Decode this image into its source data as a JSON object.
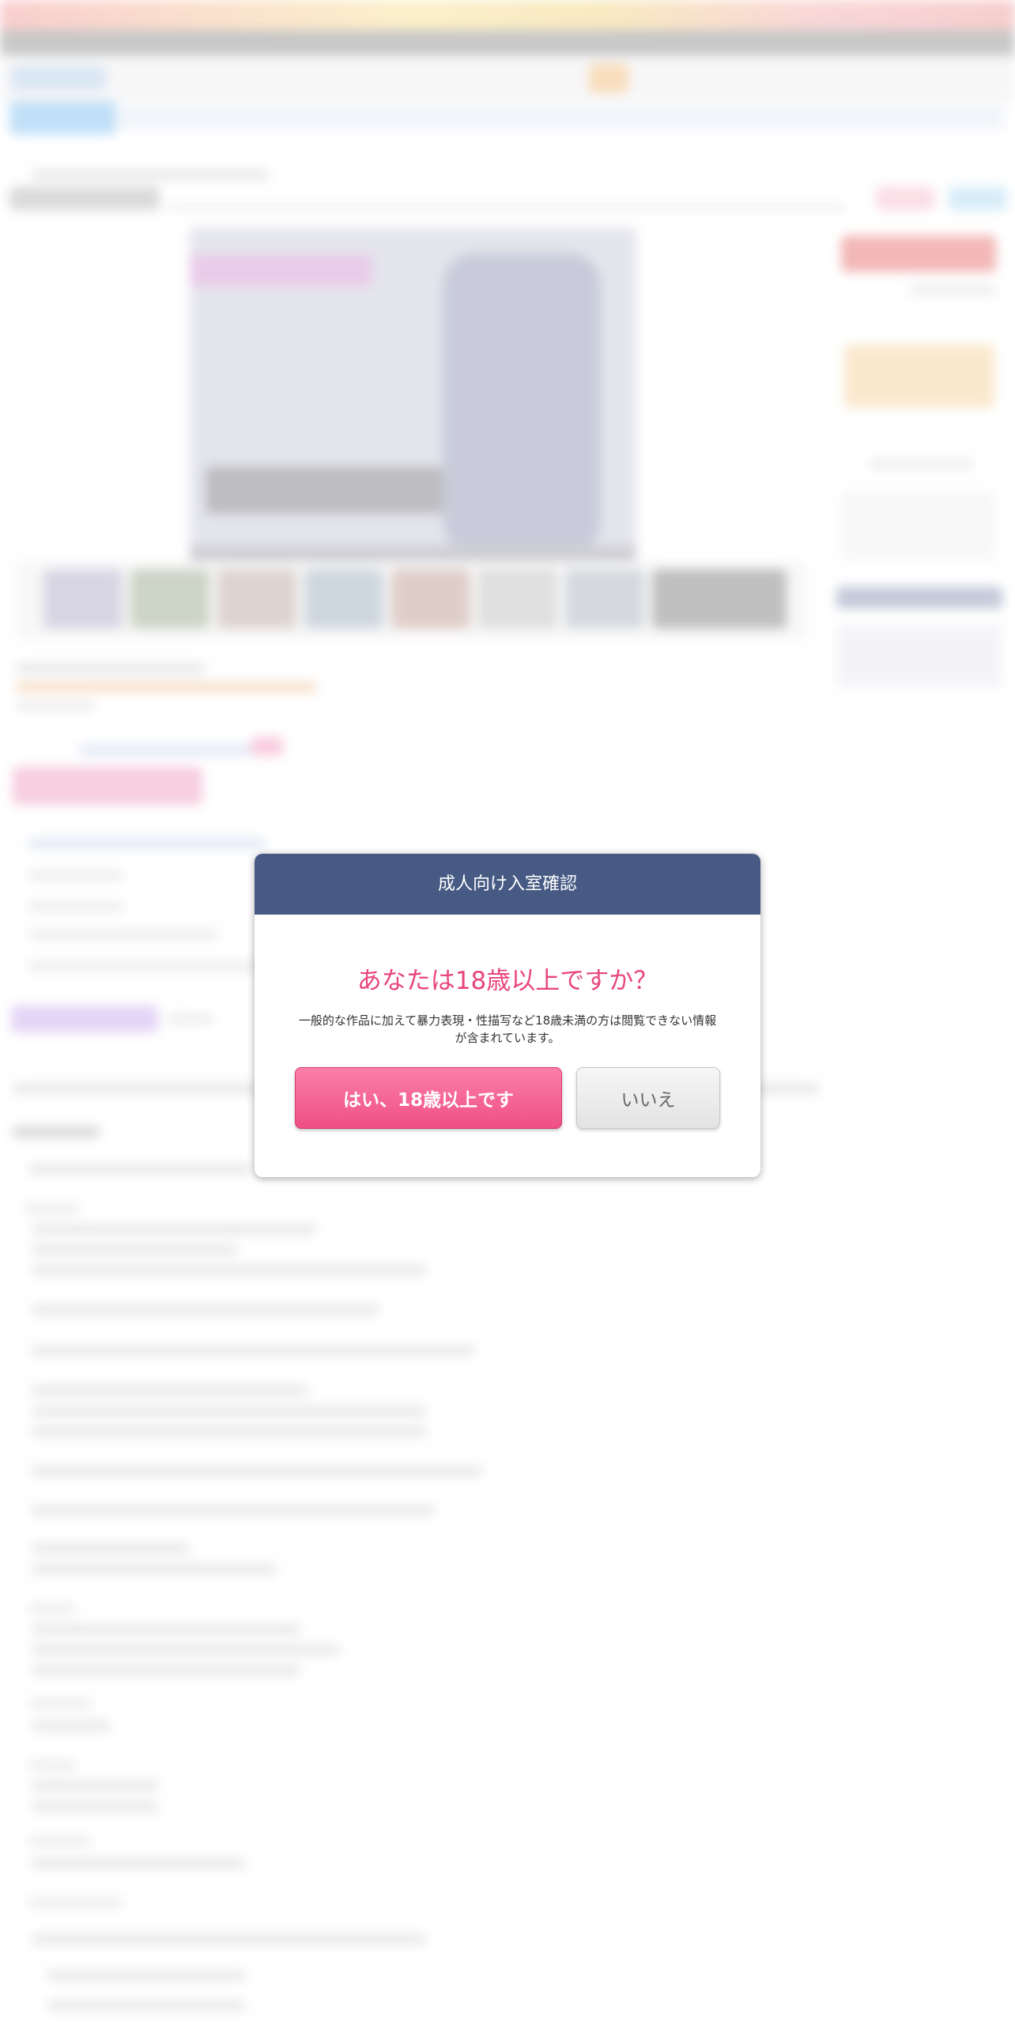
{
  "modal": {
    "header": "成人向け入室確認",
    "question": "あなたは18歳以上ですか？",
    "description": "一般的な作品に加えて暴力表現・性描写など18歳未満の方は閲覧できない情報が含まれています。",
    "yes_label": "はい、18歳以上です",
    "no_label": "いいえ"
  },
  "colors": {
    "header_bg": "#475a84",
    "question_text": "#e8457f",
    "yes_button": "#ef4f86",
    "no_button": "#e3e3e3"
  }
}
